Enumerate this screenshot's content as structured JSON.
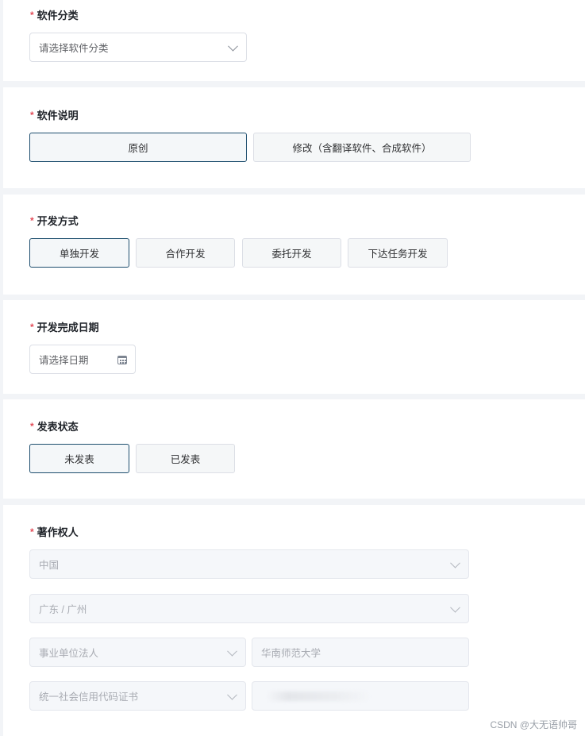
{
  "category": {
    "label": "软件分类",
    "placeholder": "请选择软件分类"
  },
  "description": {
    "label": "软件说明",
    "options": [
      "原创",
      "修改（含翻译软件、合成软件）"
    ],
    "selected": "原创"
  },
  "dev_method": {
    "label": "开发方式",
    "options": [
      "单独开发",
      "合作开发",
      "委托开发",
      "下达任务开发"
    ],
    "selected": "单独开发"
  },
  "completion_date": {
    "label": "开发完成日期",
    "placeholder": "请选择日期"
  },
  "publish_status": {
    "label": "发表状态",
    "options": [
      "未发表",
      "已发表"
    ],
    "selected": "未发表"
  },
  "copyright_holder": {
    "label": "著作权人",
    "country": "中国",
    "region": "广东 / 广州",
    "entity_type": "事业单位法人",
    "entity_name": "华南师范大学",
    "id_type": "统一社会信用代码证书"
  },
  "required_mark": "*",
  "watermark": "CSDN @大无语帅哥",
  "colors": {
    "required": "#e34d59",
    "selected_border": "#1d4e6e",
    "page_background": "#f2f4f7"
  }
}
